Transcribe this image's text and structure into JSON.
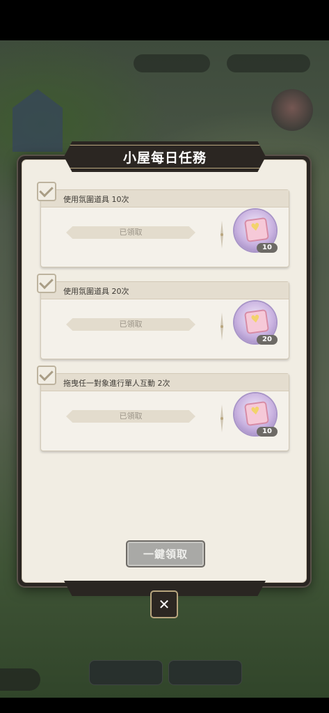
{
  "dialog": {
    "title": "小屋每日任務",
    "claim_all_label": "一鍵領取",
    "close_icon": "close-icon"
  },
  "tasks": [
    {
      "description": "使用氛圍道具 10次",
      "status": "已領取",
      "reward_count": "10",
      "reward_icon": "gift-box-icon",
      "completed": true
    },
    {
      "description": "使用氛圍道具 20次",
      "status": "已領取",
      "reward_count": "20",
      "reward_icon": "gift-box-icon",
      "completed": true
    },
    {
      "description": "拖曳任一對象進行單人互動 2次",
      "status": "已領取",
      "reward_count": "10",
      "reward_icon": "gift-box-icon",
      "completed": true
    }
  ],
  "colors": {
    "panel_bg": "#f1ede3",
    "frame": "#2a2622",
    "accent_gold": "#b8a67e",
    "disabled_button": "#a9a9a6"
  }
}
